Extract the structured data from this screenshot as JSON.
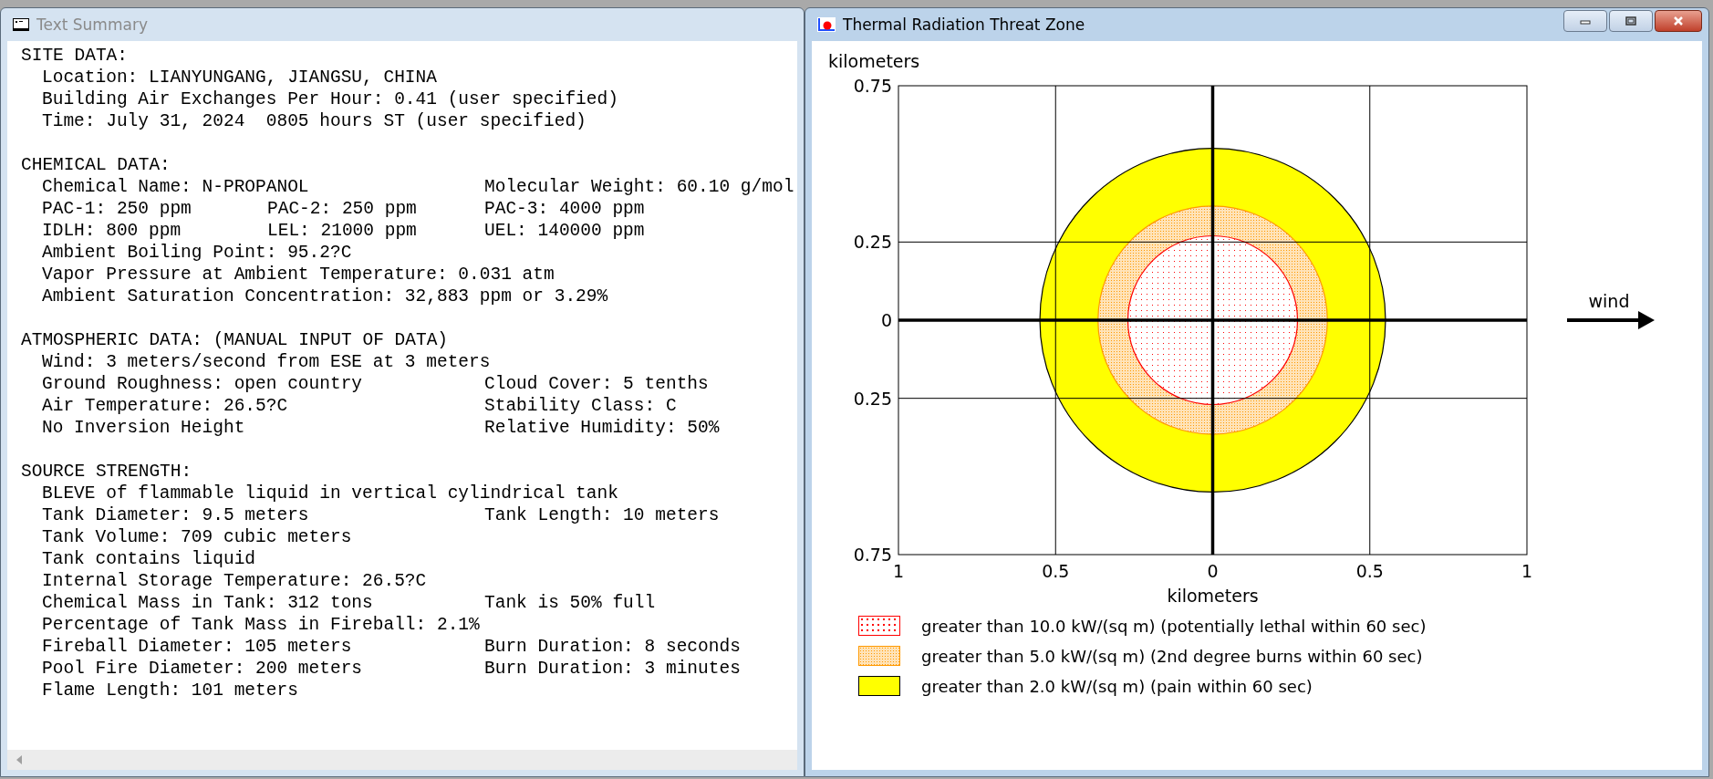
{
  "text_summary": {
    "title": "Text Summary",
    "active": false,
    "sections": [
      {
        "heading": "SITE DATA:",
        "lines": [
          {
            "text": "Location: LIANYUNGANG, JIANGSU, CHINA"
          },
          {
            "text": "Building Air Exchanges Per Hour: 0.41 (user specified)"
          },
          {
            "text": "Time: July 31, 2024  0805 hours ST (user specified)"
          }
        ]
      },
      {
        "heading": "CHEMICAL DATA:",
        "lines": [
          {
            "text": "Chemical Name: N-PROPANOL",
            "column_2": "Molecular Weight: 60.10 g/mol"
          },
          {
            "text": "PAC-1: 250 ppm",
            "middle": "PAC-2: 250 ppm",
            "column_2": "PAC-3: 4000 ppm"
          },
          {
            "text": "IDLH: 800 ppm",
            "middle": "LEL: 21000 ppm",
            "column_2": "UEL: 140000 ppm"
          },
          {
            "text": "Ambient Boiling Point: 95.2?C"
          },
          {
            "text": "Vapor Pressure at Ambient Temperature: 0.031 atm"
          },
          {
            "text": "Ambient Saturation Concentration: 32,883 ppm or 3.29%"
          }
        ]
      },
      {
        "heading": "ATMOSPHERIC DATA: (MANUAL INPUT OF DATA)",
        "lines": [
          {
            "text": "Wind: 3 meters/second from ESE at 3 meters"
          },
          {
            "text": "Ground Roughness: open country",
            "column_2": "Cloud Cover: 5 tenths"
          },
          {
            "text": "Air Temperature: 26.5?C",
            "column_2": "Stability Class: C"
          },
          {
            "text": "No Inversion Height",
            "column_2": "Relative Humidity: 50%"
          }
        ]
      },
      {
        "heading": "SOURCE STRENGTH:",
        "lines": [
          {
            "text": "BLEVE of flammable liquid in vertical cylindrical tank"
          },
          {
            "text": "Tank Diameter: 9.5 meters",
            "column_2": "Tank Length: 10 meters"
          },
          {
            "text": "Tank Volume: 709 cubic meters"
          },
          {
            "text": "Tank contains liquid"
          },
          {
            "text": "Internal Storage Temperature: 26.5?C"
          },
          {
            "text": "Chemical Mass in Tank: 312 tons",
            "column_2": "Tank is 50% full"
          },
          {
            "text": "Percentage of Tank Mass in Fireball: 2.1%"
          },
          {
            "text": "Fireball Diameter: 105 meters",
            "column_2": "Burn Duration: 8 seconds"
          },
          {
            "text": "Pool Fire Diameter: 200 meters",
            "column_2": "Burn Duration: 3 minutes"
          },
          {
            "text": "Flame Length: 101 meters"
          }
        ]
      }
    ]
  },
  "threat_zone_window": {
    "title": "Thermal Radiation Threat Zone",
    "active": true,
    "plot": {
      "y_axis_label": "kilometers",
      "x_axis_label": "kilometers",
      "x_tick_labels": [
        "1",
        "0.5",
        "0",
        "0.5",
        "1"
      ],
      "y_tick_labels": [
        "0.75",
        "0.25",
        "0",
        "0.25",
        "0.75"
      ],
      "wind_label": "wind"
    },
    "legend": [
      {
        "label": "greater than 10.0 kW/(sq m) (potentially lethal within 60 sec)",
        "color": "#ff0000",
        "kind": "dotted"
      },
      {
        "label": "greater than 5.0 kW/(sq m) (2nd degree burns within 60 sec)",
        "color": "#ff9900",
        "kind": "dense"
      },
      {
        "label": "greater than 2.0 kW/(sq m) (pain within 60 sec)",
        "color": "#ffff00",
        "kind": "solid"
      }
    ]
  }
}
